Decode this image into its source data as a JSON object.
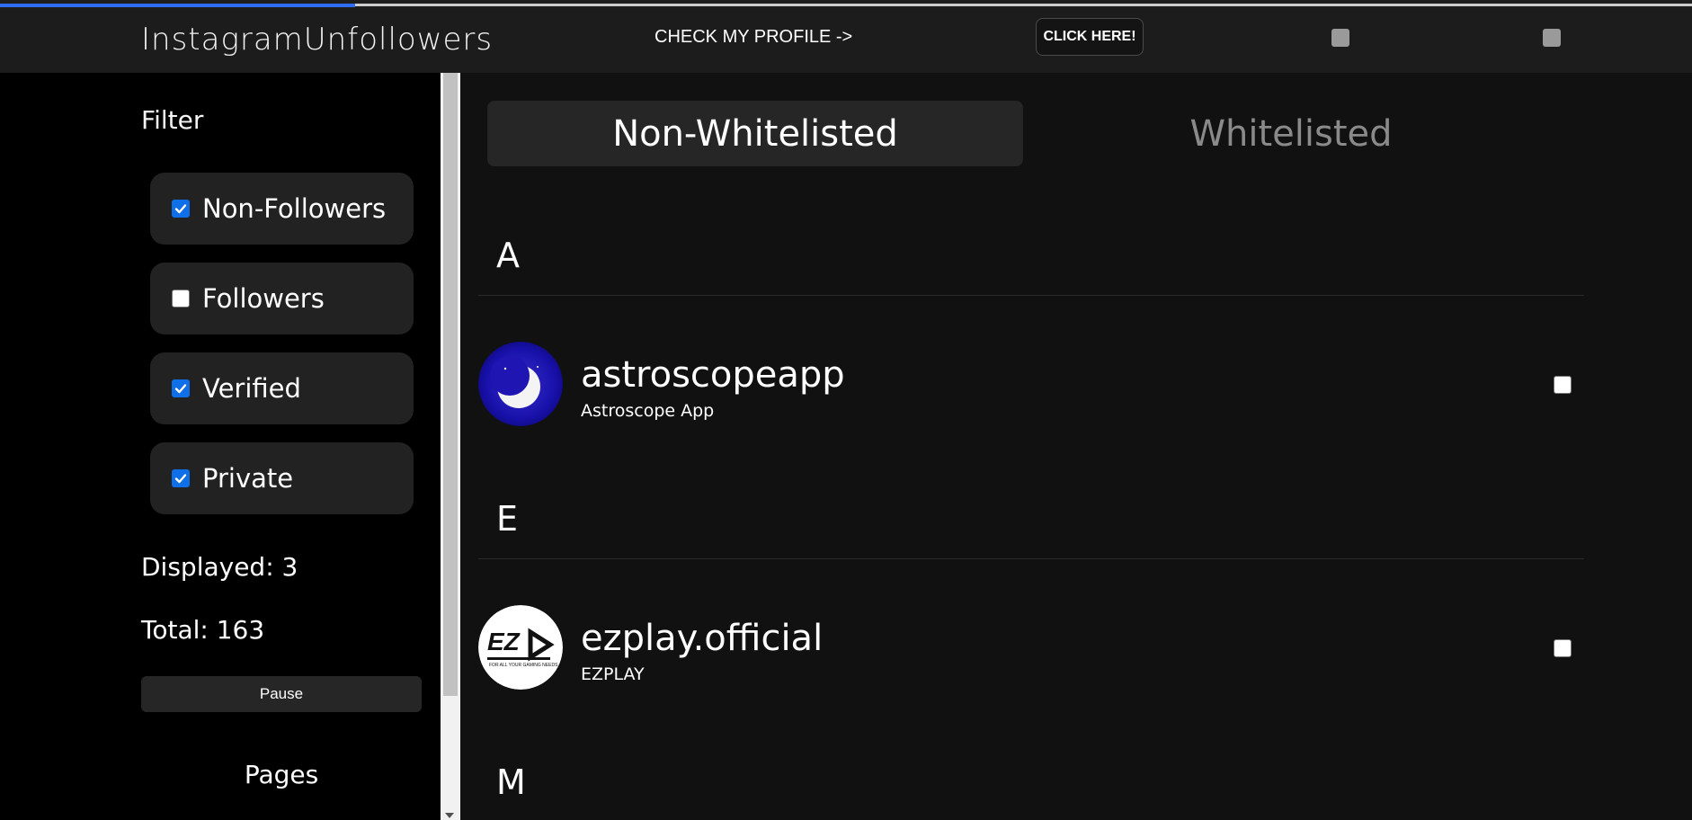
{
  "progress": {
    "fraction": 0.21,
    "color": "#2f6df6"
  },
  "header": {
    "brand": "InstagramUnfollowers",
    "check_profile": "CHECK MY PROFILE ->",
    "click_button": "CLICK HERE!"
  },
  "sidebar": {
    "filter_title": "Filter",
    "filters": [
      {
        "label": "Non-Followers",
        "checked": true
      },
      {
        "label": "Followers",
        "checked": false
      },
      {
        "label": "Verified",
        "checked": true
      },
      {
        "label": "Private",
        "checked": true
      }
    ],
    "displayed": "Displayed: 3",
    "total": "Total: 163",
    "pause_label": "Pause",
    "pages_title": "Pages"
  },
  "tabs": [
    {
      "label": "Non-Whitelisted",
      "active": true
    },
    {
      "label": "Whitelisted",
      "active": false
    }
  ],
  "sections": [
    {
      "letter": "A",
      "users": [
        {
          "username": "astroscopeapp",
          "full_name": "Astroscope App",
          "avatar": "moon-avatar"
        }
      ]
    },
    {
      "letter": "E",
      "users": [
        {
          "username": "ezplay.official",
          "full_name": "EZPLAY",
          "avatar": "ezplay-logo-avatar"
        }
      ]
    },
    {
      "letter": "M",
      "users": []
    }
  ],
  "colors": {
    "accent": "#0f6fe8",
    "background": "#111111",
    "sidebar": "#000000"
  }
}
